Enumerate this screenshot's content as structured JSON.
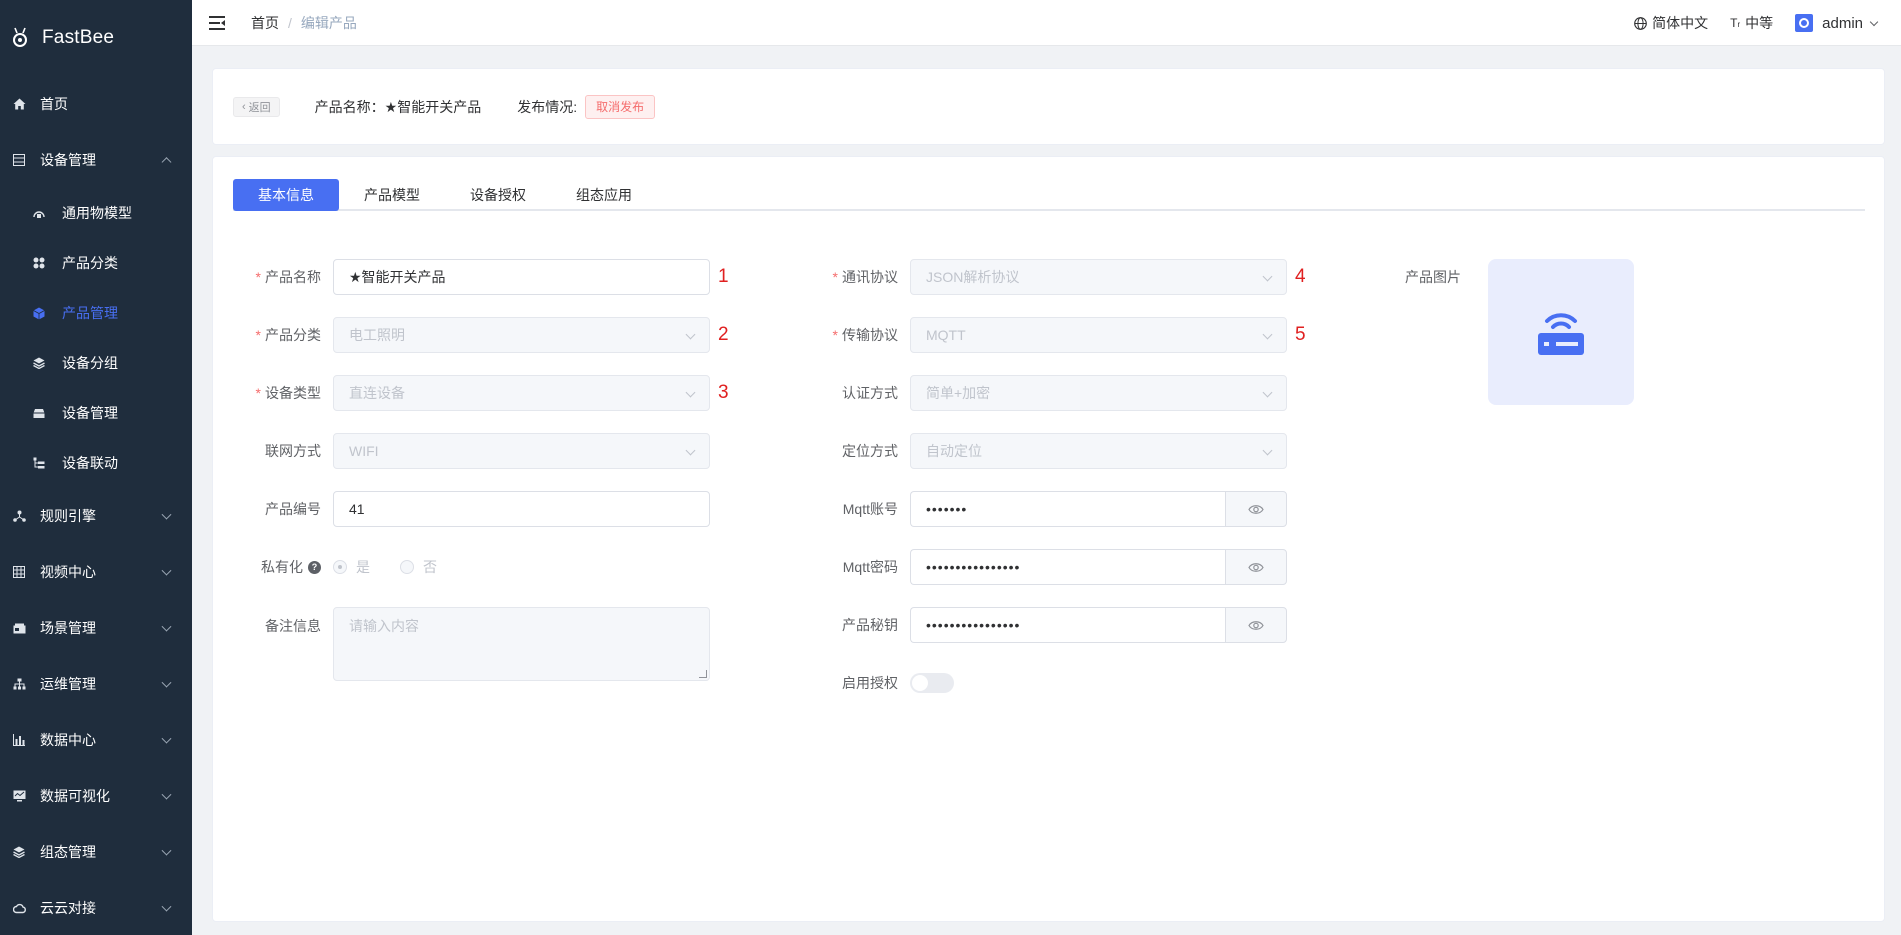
{
  "app": {
    "name": "FastBee"
  },
  "sidebar": {
    "items": [
      {
        "label": "首页",
        "icon": "home-icon"
      },
      {
        "label": "设备管理",
        "icon": "device-icon",
        "expanded": true,
        "children": [
          {
            "label": "通用物模型",
            "icon": "model-icon"
          },
          {
            "label": "产品分类",
            "icon": "category-icon"
          },
          {
            "label": "产品管理",
            "icon": "product-icon",
            "active": true
          },
          {
            "label": "设备分组",
            "icon": "group-icon"
          },
          {
            "label": "设备管理",
            "icon": "device-manage-icon"
          },
          {
            "label": "设备联动",
            "icon": "linkage-icon"
          }
        ]
      },
      {
        "label": "规则引擎",
        "icon": "rule-icon"
      },
      {
        "label": "视频中心",
        "icon": "video-icon"
      },
      {
        "label": "场景管理",
        "icon": "scene-icon"
      },
      {
        "label": "运维管理",
        "icon": "ops-icon"
      },
      {
        "label": "数据中心",
        "icon": "data-icon"
      },
      {
        "label": "数据可视化",
        "icon": "visual-icon"
      },
      {
        "label": "组态管理",
        "icon": "config-icon"
      },
      {
        "label": "云云对接",
        "icon": "cloud-icon"
      }
    ]
  },
  "header": {
    "breadcrumb": [
      "首页",
      "编辑产品"
    ],
    "language": "简体中文",
    "size": "中等",
    "user": "admin"
  },
  "topbar": {
    "back": "返回",
    "product_name_label": "产品名称：",
    "product_name": "★智能开关产品",
    "publish_label": "发布情况:",
    "publish_status": "取消发布"
  },
  "tabs": [
    "基本信息",
    "产品模型",
    "设备授权",
    "组态应用"
  ],
  "form": {
    "product_name": {
      "label": "产品名称",
      "value": "★智能开关产品",
      "annot": "1"
    },
    "category": {
      "label": "产品分类",
      "value": "电工照明",
      "annot": "2"
    },
    "device_type": {
      "label": "设备类型",
      "value": "直连设备",
      "annot": "3"
    },
    "network": {
      "label": "联网方式",
      "value": "WIFI"
    },
    "product_no": {
      "label": "产品编号",
      "value": "41"
    },
    "private": {
      "label": "私有化",
      "help": "?",
      "options": [
        "是",
        "否"
      ],
      "selected": "是"
    },
    "remark": {
      "label": "备注信息",
      "placeholder": "请输入内容"
    },
    "protocol": {
      "label": "通讯协议",
      "value": "JSON解析协议",
      "annot": "4"
    },
    "transport": {
      "label": "传输协议",
      "value": "MQTT",
      "annot": "5"
    },
    "auth_mode": {
      "label": "认证方式",
      "value": "简单+加密"
    },
    "locate_mode": {
      "label": "定位方式",
      "value": "自动定位"
    },
    "mqtt_account": {
      "label": "Mqtt账号",
      "value": "•••••••"
    },
    "mqtt_password": {
      "label": "Mqtt密码",
      "value": "••••••••••••••••"
    },
    "product_secret": {
      "label": "产品秘钥",
      "value": "••••••••••••••••"
    },
    "enable_auth": {
      "label": "启用授权",
      "enabled": false
    },
    "image": {
      "label": "产品图片"
    }
  },
  "colors": {
    "primary": "#486ff2",
    "sidebar": "#1f2d3d",
    "annotation": "#e02020",
    "danger": "#f56c6c"
  }
}
